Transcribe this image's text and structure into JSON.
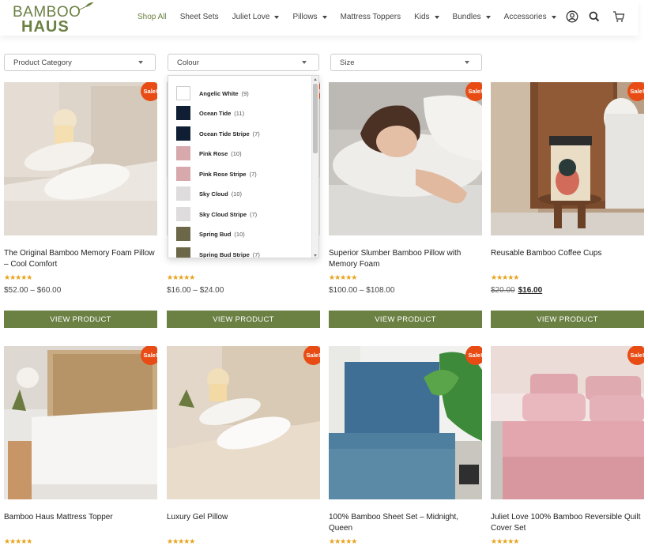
{
  "brand": {
    "line1": "BAMBOO",
    "line2": "HAUS"
  },
  "nav": [
    {
      "label": "Shop All",
      "caret": false,
      "active": true
    },
    {
      "label": "Sheet Sets",
      "caret": false
    },
    {
      "label": "Juliet Love",
      "caret": true
    },
    {
      "label": "Pillows",
      "caret": true
    },
    {
      "label": "Mattress Toppers",
      "caret": false
    },
    {
      "label": "Kids",
      "caret": true
    },
    {
      "label": "Bundles",
      "caret": true
    },
    {
      "label": "Accessories",
      "caret": true
    }
  ],
  "filters": {
    "category": "Product Category",
    "colour": "Colour",
    "size": "Size"
  },
  "colour_options": [
    {
      "name": "Angelic White",
      "count": "(9)",
      "color": "#ffffff"
    },
    {
      "name": "Ocean Tide",
      "count": "(11)",
      "color": "#0f1e33"
    },
    {
      "name": "Ocean Tide Stripe",
      "count": "(7)",
      "color": "#0f1e33"
    },
    {
      "name": "Pink Rose",
      "count": "(10)",
      "color": "#d8a9ac"
    },
    {
      "name": "Pink Rose Stripe",
      "count": "(7)",
      "color": "#d8a9ac"
    },
    {
      "name": "Sky Cloud",
      "count": "(10)",
      "color": "#dedcdd"
    },
    {
      "name": "Sky Cloud Stripe",
      "count": "(7)",
      "color": "#dedcdd"
    },
    {
      "name": "Spring Bud",
      "count": "(10)",
      "color": "#6c6748"
    },
    {
      "name": "Spring Bud Stripe",
      "count": "(7)",
      "color": "#6c6748"
    }
  ],
  "sale_label": "Sale!",
  "stars": "★★★★★",
  "button_label": "VIEW PRODUCT",
  "products_row1": [
    {
      "title": "The Original Bamboo Memory Foam Pillow – Cool Comfort",
      "price": "$52.00 – $60.00"
    },
    {
      "title": "",
      "price": "$16.00 – $24.00"
    },
    {
      "title": "Superior Slumber Bamboo Pillow with Memory Foam",
      "price": "$100.00 – $108.00"
    },
    {
      "title": "Reusable Bamboo Coffee Cups",
      "price_old": "$20.00",
      "price_new": "$16.00"
    }
  ],
  "products_row2": [
    {
      "title": "Bamboo Haus Mattress Topper"
    },
    {
      "title": "Luxury Gel Pillow"
    },
    {
      "title": "100% Bamboo Sheet Set – Midnight, Queen"
    },
    {
      "title": "Juliet Love 100% Bamboo Reversible Quilt Cover Set"
    }
  ],
  "colors": {
    "brand_green": "#6b8043",
    "sale_orange": "#e84c14",
    "star_gold": "#e8a21a"
  }
}
